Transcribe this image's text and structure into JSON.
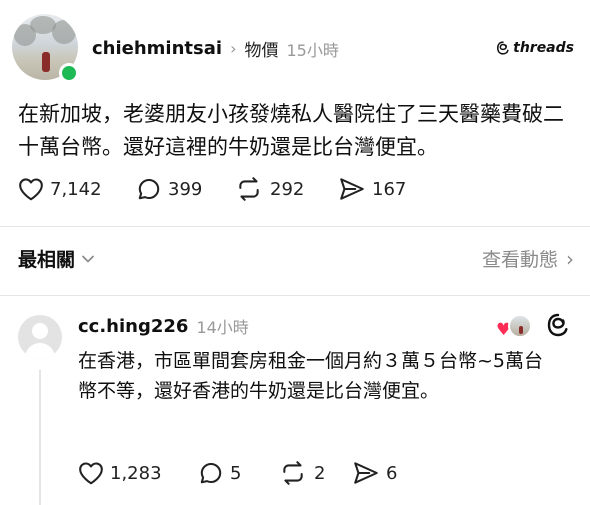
{
  "post": {
    "username": "chiehmintsai",
    "topic": "物價",
    "time": "15小時",
    "logo_text": "threads",
    "text": "在新加坡，老婆朋友小孩發燒私人醫院住了三天醫藥費破二十萬台幣。還好這裡的牛奶還是比台灣便宜。",
    "likes": "7,142",
    "comments": "399",
    "reposts": "292",
    "shares": "167"
  },
  "filter": {
    "sort_label": "最相關",
    "activity_link": "查看動態"
  },
  "reply": {
    "username": "cc.hing226",
    "time": "14小時",
    "text": "在香港，市區單間套房租金一個月約３萬５台幣~5萬台幣不等，還好香港的牛奶還是比台灣便宜。",
    "likes": "1,283",
    "comments": "5",
    "reposts": "2",
    "shares": "6"
  },
  "colors": {
    "online_dot": "#1db954",
    "liked_heart": "#ff2d55",
    "muted_text": "#999999"
  }
}
